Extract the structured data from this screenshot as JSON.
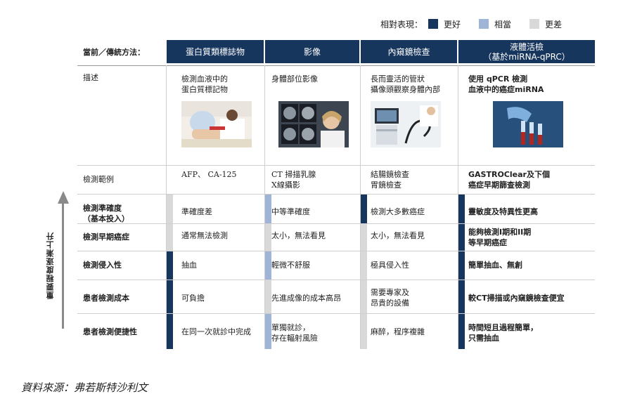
{
  "colors": {
    "navy": "#17365d",
    "blue": "#17365d",
    "medium": "#9fb4d6",
    "gray": "#d9d9d9"
  },
  "legend": {
    "label": "相對表現：",
    "better": "更好",
    "equal": "相當",
    "worse": "更差"
  },
  "header": {
    "label": "當前／傳統方法：",
    "columns": [
      "蛋白質類標誌物",
      "影像",
      "內窺鏡檢查",
      "液體活檢"
    ],
    "last_sub": "（基於miRNA-qPRC）"
  },
  "rows": {
    "description": {
      "label": "描述",
      "cells": [
        "檢測血液中的\n蛋白質標記物",
        "身體部位影像",
        "長而靈活的管狀\n攝像頭觀察身體內部",
        "使用 qPCR 檢測\n血液中的癌症miRNA"
      ]
    },
    "scope": {
      "label": "檢測範例",
      "cells": [
        "AFP、 CA-125",
        "CT 掃描乳腺\nX線攝影",
        "結腸鏡檢查\n胃鏡檢查",
        "GASTROClear及下個\n癌症早期篩查檢測"
      ]
    },
    "accuracy": {
      "label": "檢測準確度\n（基本投入）",
      "cells": [
        "準確度差",
        "中等準確度",
        "檢測大多數癌症",
        "靈敏度及特異性更高"
      ],
      "ratings": [
        "gray",
        "medium",
        "blue",
        "blue"
      ]
    },
    "early": {
      "label": "檢測早期癌症",
      "cells": [
        "通常無法檢測",
        "太小，無法看見",
        "太小，無法看見",
        "能夠檢測I期和II期\n等早期癌症"
      ],
      "ratings": [
        "gray",
        "gray",
        "gray",
        "blue"
      ]
    },
    "invasive": {
      "label": "檢測侵入性",
      "cells": [
        "抽血",
        "輕微不舒服",
        "極具侵入性",
        "簡單抽血、無創"
      ],
      "ratings": [
        "blue",
        "medium",
        "gray",
        "blue"
      ]
    },
    "cost": {
      "label": "患者檢測成本",
      "cells": [
        "可負擔",
        "先進成像的成本高昂",
        "需要專家及\n昂貴的設備",
        "較CT掃描或內窺鏡檢查便宜"
      ],
      "ratings": [
        "blue",
        "gray",
        "gray",
        "blue"
      ]
    },
    "convenience": {
      "label": "患者檢測便捷性",
      "cells": [
        "在同一次就診中完成",
        "單獨就診，\n存在輻射風險",
        "麻醉，程序複雜",
        "時間短且過程簡單，\n只需抽血"
      ],
      "ratings": [
        "blue",
        "medium",
        "gray",
        "blue"
      ]
    }
  },
  "arrow_label": "重要程度逐漸上升",
  "source": "資料來源：弗若斯特沙利文"
}
